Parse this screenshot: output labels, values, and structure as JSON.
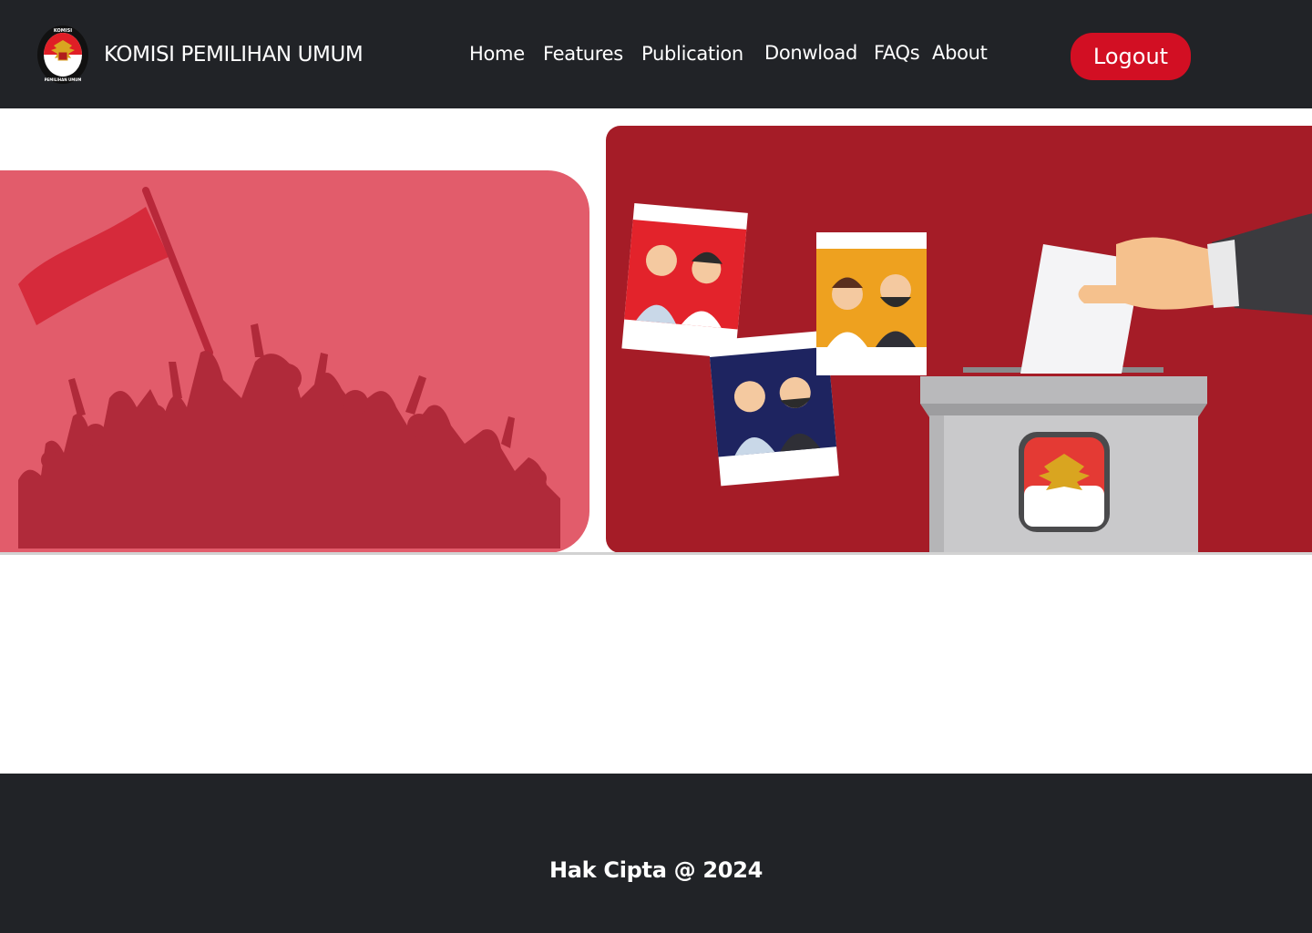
{
  "header": {
    "brand_name": "KOMISI PEMILIHAN UMUM",
    "logo_icon": "kpu-garuda-emblem-icon",
    "logo_ring_top_text": "KOMISI",
    "logo_ring_bottom_text": "PEMILIHAN UMUM",
    "nav": [
      {
        "label": "Home"
      },
      {
        "label": "Features"
      },
      {
        "label": "Publication"
      },
      {
        "label": "Donwload"
      },
      {
        "label": "FAQs"
      },
      {
        "label": "About"
      }
    ],
    "logout_label": "Logout"
  },
  "hero": {
    "left_illustration": "protest-crowd-with-flag",
    "right_illustration": "ballot-box-voting"
  },
  "footer": {
    "copyright": "Hak Cipta @ 2024"
  },
  "colors": {
    "header_bg": "#212327",
    "accent_red": "#d20f23",
    "panel_pink": "#e25c6b",
    "panel_darkred": "#a51c27"
  }
}
